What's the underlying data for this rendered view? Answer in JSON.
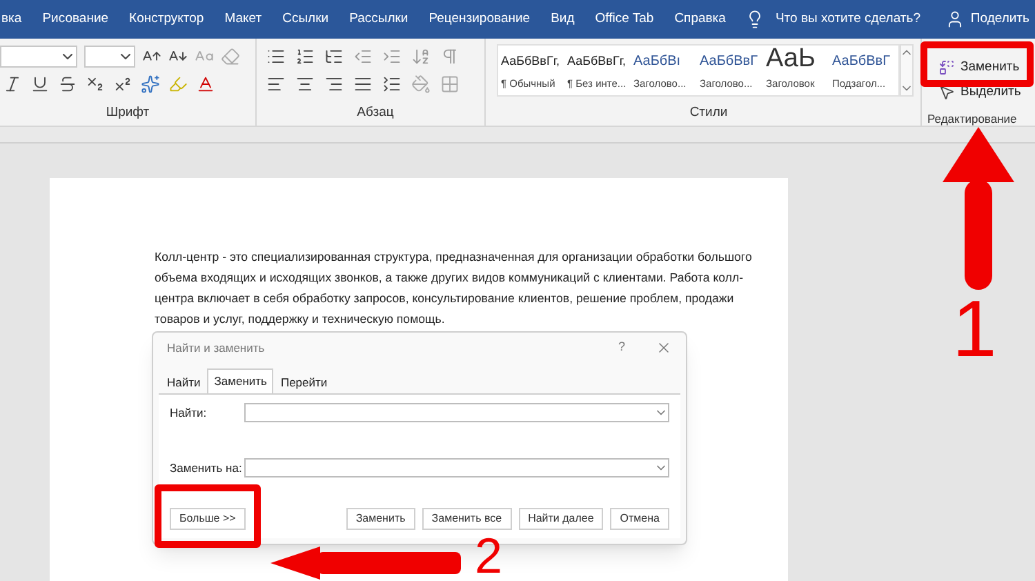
{
  "menu_tabs": [
    "вка",
    "Рисование",
    "Конструктор",
    "Макет",
    "Ссылки",
    "Рассылки",
    "Рецензирование",
    "Вид",
    "Office Tab",
    "Справка"
  ],
  "tell_me": {
    "placeholder": "Что вы хотите сделать?"
  },
  "share": "Поделить",
  "ribbon": {
    "font_group": {
      "label": "Шрифт"
    },
    "paragraph_group": {
      "label": "Абзац"
    },
    "styles": {
      "label": "Стили",
      "items": [
        {
          "preview": "АаБбВвГг,",
          "name": "¶ Обычный",
          "kind": "body"
        },
        {
          "preview": "АаБбВвГг,",
          "name": "¶ Без инте...",
          "kind": "body"
        },
        {
          "preview": "АаБбВı",
          "name": "Заголово...",
          "kind": "heading"
        },
        {
          "preview": "АаБбВвГ",
          "name": "Заголово...",
          "kind": "heading"
        },
        {
          "preview": "АаЬ",
          "name": "Заголовок",
          "kind": "title"
        },
        {
          "preview": "АаБбВвГ",
          "name": "Подзагол...",
          "kind": "heading"
        }
      ]
    },
    "editing": {
      "label": "Редактирование",
      "buttons": [
        "Заменить",
        "Выделить"
      ]
    }
  },
  "document": {
    "paragraph": "Колл-центр - это специализированная структура, предназначенная для организации обработки большого объема входящих и исходящих звонков, а также других видов коммуникаций с клиентами. Работа колл-центра включает в себя обработку запросов, консультирование клиентов, решение проблем, продажи товаров и услуг, поддержку и техническую помощь."
  },
  "dialog": {
    "title": "Найти и заменить",
    "help": "?",
    "tabs": [
      {
        "label": "Найти",
        "selected": false
      },
      {
        "label": "Заменить",
        "selected": true
      },
      {
        "label": "Перейти",
        "selected": false
      }
    ],
    "fields": [
      {
        "label": "Найти:"
      },
      {
        "label": "Заменить на:"
      }
    ],
    "buttons": [
      {
        "label": "Больше >>",
        "highlighted": true
      },
      {
        "label": "Заменить",
        "highlighted": false
      },
      {
        "label": "Заменить все",
        "highlighted": false
      },
      {
        "label": "Найти далее",
        "highlighted": false
      },
      {
        "label": "Отмена",
        "highlighted": false
      }
    ]
  },
  "annotations": [
    {
      "number": "1"
    },
    {
      "number": "2"
    }
  ]
}
